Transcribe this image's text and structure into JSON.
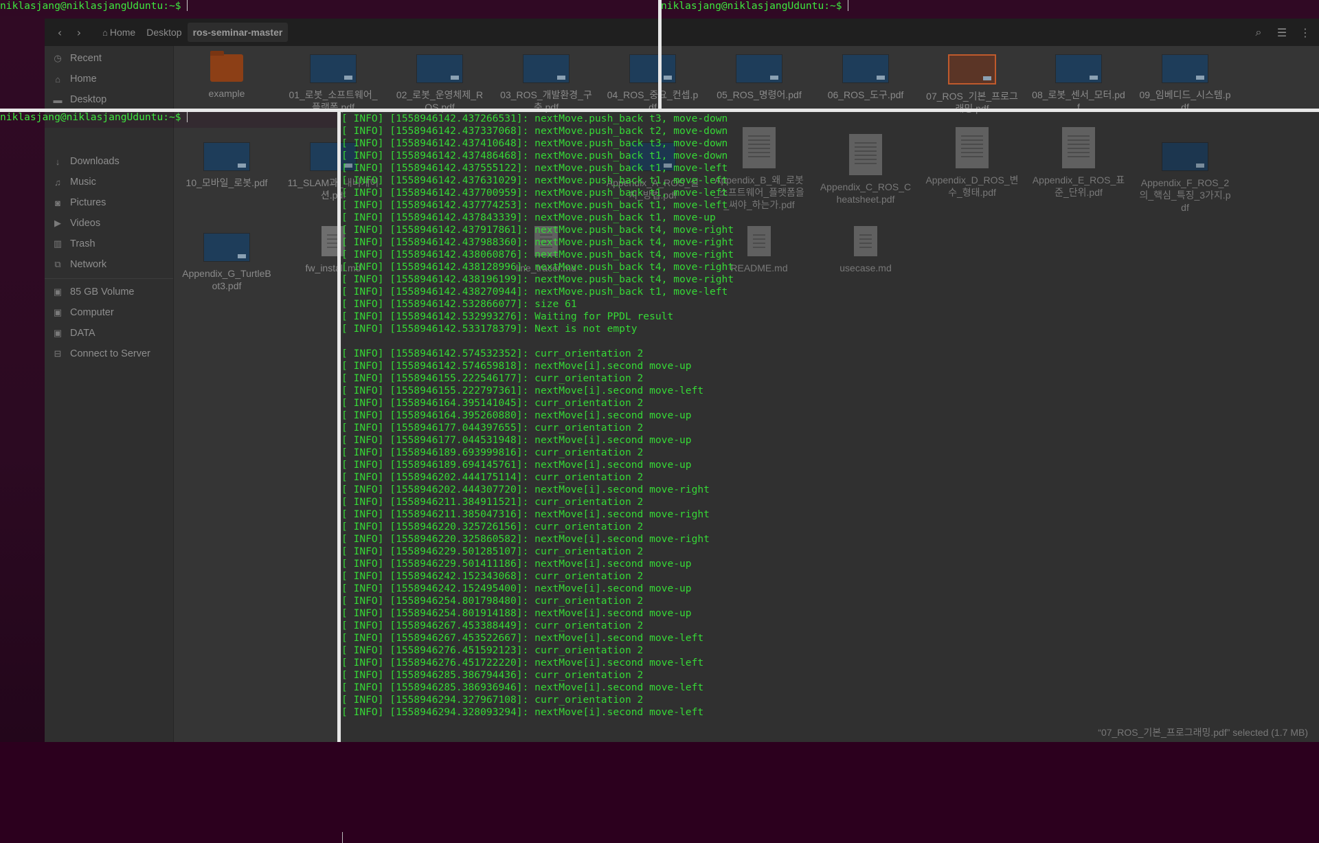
{
  "terminal": {
    "prompt": "niklasjang@niklasjangUduntu:~$",
    "log_lines": [
      "[ INFO] [1558946142.437266531]: nextMove.push_back t3, move-down",
      "[ INFO] [1558946142.437337068]: nextMove.push_back t2, move-down",
      "[ INFO] [1558946142.437410648]: nextMove.push_back t3, move-down",
      "[ INFO] [1558946142.437486468]: nextMove.push_back t1, move-down",
      "[ INFO] [1558946142.437555122]: nextMove.push_back t1, move-left",
      "[ INFO] [1558946142.437631029]: nextMove.push_back t1, move-left",
      "[ INFO] [1558946142.437700959]: nextMove.push_back t1, move-left",
      "[ INFO] [1558946142.437774253]: nextMove.push_back t1, move-left",
      "[ INFO] [1558946142.437843339]: nextMove.push_back t1, move-up",
      "[ INFO] [1558946142.437917861]: nextMove.push_back t4, move-right",
      "[ INFO] [1558946142.437988360]: nextMove.push_back t4, move-right",
      "[ INFO] [1558946142.438060876]: nextMove.push_back t4, move-right",
      "[ INFO] [1558946142.438128996]: nextMove.push_back t4, move-right",
      "[ INFO] [1558946142.438196199]: nextMove.push_back t4, move-right",
      "[ INFO] [1558946142.438270944]: nextMove.push_back t1, move-left",
      "[ INFO] [1558946142.532866077]: size 61",
      "[ INFO] [1558946142.532993276]: Waiting for PPDL result",
      "[ INFO] [1558946142.533178379]: Next is not empty",
      "",
      "[ INFO] [1558946142.574532352]: curr_orientation 2",
      "[ INFO] [1558946142.574659818]: nextMove[i].second move-up",
      "[ INFO] [1558946155.222546177]: curr_orientation 2",
      "[ INFO] [1558946155.222797361]: nextMove[i].second move-left",
      "[ INFO] [1558946164.395141045]: curr_orientation 2",
      "[ INFO] [1558946164.395260880]: nextMove[i].second move-up",
      "[ INFO] [1558946177.044397655]: curr_orientation 2",
      "[ INFO] [1558946177.044531948]: nextMove[i].second move-up",
      "[ INFO] [1558946189.693999816]: curr_orientation 2",
      "[ INFO] [1558946189.694145761]: nextMove[i].second move-up",
      "[ INFO] [1558946202.444175114]: curr_orientation 2",
      "[ INFO] [1558946202.444307720]: nextMove[i].second move-right",
      "[ INFO] [1558946211.384911521]: curr_orientation 2",
      "[ INFO] [1558946211.385047316]: nextMove[i].second move-right",
      "[ INFO] [1558946220.325726156]: curr_orientation 2",
      "[ INFO] [1558946220.325860582]: nextMove[i].second move-right",
      "[ INFO] [1558946229.501285107]: curr_orientation 2",
      "[ INFO] [1558946229.501411186]: nextMove[i].second move-up",
      "[ INFO] [1558946242.152343068]: curr_orientation 2",
      "[ INFO] [1558946242.152495400]: nextMove[i].second move-up",
      "[ INFO] [1558946254.801798480]: curr_orientation 2",
      "[ INFO] [1558946254.801914188]: nextMove[i].second move-up",
      "[ INFO] [1558946267.453388449]: curr_orientation 2",
      "[ INFO] [1558946267.453522667]: nextMove[i].second move-left",
      "[ INFO] [1558946276.451592123]: curr_orientation 2",
      "[ INFO] [1558946276.451722220]: nextMove[i].second move-left",
      "[ INFO] [1558946285.386794436]: curr_orientation 2",
      "[ INFO] [1558946285.386936946]: nextMove[i].second move-left",
      "[ INFO] [1558946294.327967108]: curr_orientation 2",
      "[ INFO] [1558946294.328093294]: nextMove[i].second move-left"
    ]
  },
  "file_manager": {
    "breadcrumbs": [
      "Home",
      "Desktop",
      "ros-seminar-master"
    ],
    "places": {
      "recent": "Recent",
      "home": "Home",
      "desktop": "Desktop",
      "downloads": "Downloads",
      "music": "Music",
      "pictures": "Pictures",
      "videos": "Videos",
      "trash": "Trash",
      "network": "Network",
      "volume": "85 GB Volume",
      "computer": "Computer",
      "data": "DATA",
      "connect": "Connect to Server"
    },
    "files": {
      "example": "example",
      "f01": "01_로봇_소프트웨어_플랫폼.pdf",
      "f02": "02_로봇_운영체제_ROS.pdf",
      "f03": "03_ROS_개발환경_구축.pdf",
      "f04": "04_ROS_중요_컨셉.pdf",
      "f05": "05_ROS_명령어.pdf",
      "f06": "06_ROS_도구.pdf",
      "f07": "07_ROS_기본_프로그래밍.pdf",
      "f08": "08_로봇_센서_모터.pdf",
      "f09": "09_임베디드_시스템.pdf",
      "f10": "10_모바일_로봇.pdf",
      "f11": "11_SLAM과_내비게이션.pdf",
      "fA": "Appendix_A_ROS_설치_방법.pdf",
      "fB": "Appendix_B_왜_로봇_소프트웨어_플랫폼을_써야_하는가.pdf",
      "fC": "Appendix_C_ROS_Cheatsheet.pdf",
      "fD": "Appendix_D_ROS_변수_형태.pdf",
      "fE": "Appendix_E_ROS_표준_단위.pdf",
      "fF": "Appendix_F_ROS_2의_핵심_특징_3가지.pdf",
      "fG": "Appendix_G_TurtleBot3.pdf",
      "fw": "fw_install.md",
      "line": "line_tracer.md",
      "readme": "README.md",
      "usecase": "usecase.md"
    },
    "status": "“07_ROS_기본_프로그래밍.pdf” selected (1.7 MB)"
  }
}
